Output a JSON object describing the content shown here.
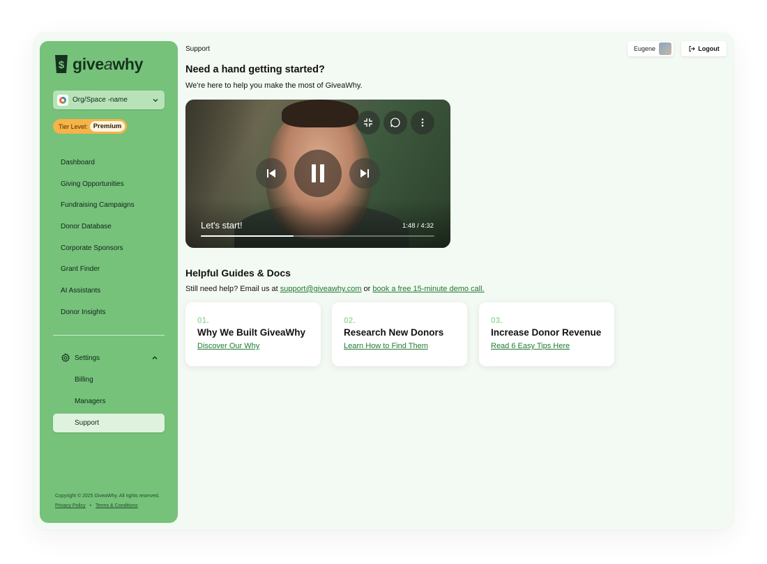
{
  "brand": {
    "name_prefix": "give",
    "name_italic": "a",
    "name_suffix": "why"
  },
  "org": {
    "name": "Org/Space -name"
  },
  "tier": {
    "label": "Tier Level:",
    "value": "Premium"
  },
  "nav": [
    "Dashboard",
    "Giving Opportunities",
    "Fundraising Campaigns",
    "Donor Database",
    "Corporate Sponsors",
    "Grant Finder",
    "AI Assistants",
    "Donor Insights"
  ],
  "settings": {
    "label": "Settings",
    "items": [
      "Billing",
      "Managers",
      "Support"
    ]
  },
  "footer": {
    "copyright": "Copyright © 2025 GiveaWhy. All rights reserved.",
    "privacy": "Privacy Policy",
    "separator": "•",
    "terms": "Terms & Conditions"
  },
  "header": {
    "breadcrumb": "Support",
    "user": "Eugene",
    "logout": "Logout"
  },
  "hero": {
    "title": "Need a hand getting started?",
    "subtitle": "We're here to help you make the most of GiveaWhy."
  },
  "video": {
    "title": "Let's start!",
    "time": "1:48 / 4:32",
    "progress": 0.3971
  },
  "guides": {
    "title": "Helpful Guides & Docs",
    "help_text": "Still need help? Email us at ",
    "email": "support@giveawhy.com",
    "or": " or ",
    "demo": "book a free 15-minute demo call.",
    "cards": [
      {
        "num": "01.",
        "title": "Why We Built GiveaWhy",
        "link": "Discover Our Why"
      },
      {
        "num": "02.",
        "title": "Research New Donors",
        "link": "Learn How to Find Them"
      },
      {
        "num": "03.",
        "title": "Increase Donor Revenue",
        "link": "Read 6 Easy Tips Here"
      }
    ]
  },
  "colors": {
    "sidebar": "#76c27a",
    "accent_link": "#1f7a33",
    "tier_badge": "#f7b347",
    "card_number": "#a6dca9"
  },
  "icons": [
    "logo-icon",
    "org-icon",
    "chevron-down-icon",
    "gear-icon",
    "chevron-up-icon",
    "logout-icon",
    "minimize-icon",
    "chat-icon",
    "more-vertical-icon",
    "skip-back-icon",
    "pause-icon",
    "skip-forward-icon"
  ]
}
